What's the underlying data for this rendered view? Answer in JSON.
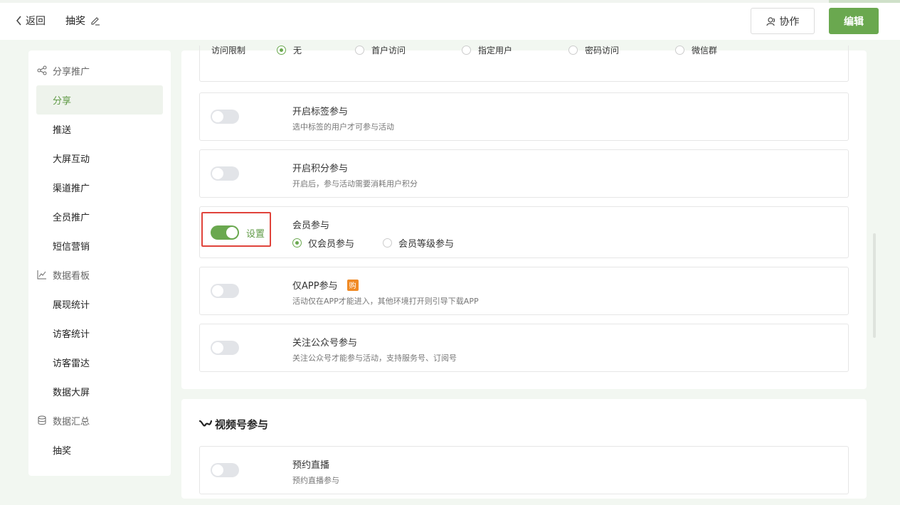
{
  "header": {
    "back_label": "返回",
    "title": "抽奖",
    "collab_label": "协作",
    "edit_label": "编辑"
  },
  "sidebar": {
    "groups": [
      {
        "label": "分享推广",
        "icon": "share-icon",
        "items": [
          "分享",
          "推送",
          "大屏互动",
          "渠道推广",
          "全员推广",
          "短信营销"
        ]
      },
      {
        "label": "数据看板",
        "icon": "chart-icon",
        "items": [
          "展现统计",
          "访客统计",
          "访客雷达",
          "数据大屏"
        ]
      },
      {
        "label": "数据汇总",
        "icon": "database-icon",
        "items": [
          "抽奖"
        ]
      }
    ],
    "active_item": "分享"
  },
  "access": {
    "label": "访问限制",
    "options": [
      {
        "label": "无",
        "checked": true
      },
      {
        "label": "首户访问",
        "checked": false
      },
      {
        "label": "指定用户",
        "checked": false
      },
      {
        "label": "密码访问",
        "checked": false
      },
      {
        "label": "微信群",
        "checked": false
      }
    ]
  },
  "rows": [
    {
      "title": "开启标签参与",
      "desc": "选中标签的用户才可参与活动",
      "on": false
    },
    {
      "title": "开启积分参与",
      "desc": "开启后，参与活动需要消耗用户积分",
      "on": false
    },
    {
      "title": "会员参与",
      "on": true,
      "setting_label": "设置",
      "options": [
        {
          "label": "仅会员参与",
          "checked": true
        },
        {
          "label": "会员等级参与",
          "checked": false
        }
      ]
    },
    {
      "title": "仅APP参与",
      "badge": "购",
      "desc": "活动仅在APP才能进入，其他环境打开则引导下载APP",
      "on": false
    },
    {
      "title": "关注公众号参与",
      "desc": "关注公众号才能参与活动，支持服务号、订阅号",
      "on": false
    }
  ],
  "video_section": {
    "title": "视频号参与",
    "rows": [
      {
        "title": "预约直播",
        "desc": "预约直播参与",
        "on": false
      }
    ]
  },
  "colors": {
    "accent": "#6aa84f",
    "highlight": "#e0433b",
    "badge": "#f08a24"
  }
}
